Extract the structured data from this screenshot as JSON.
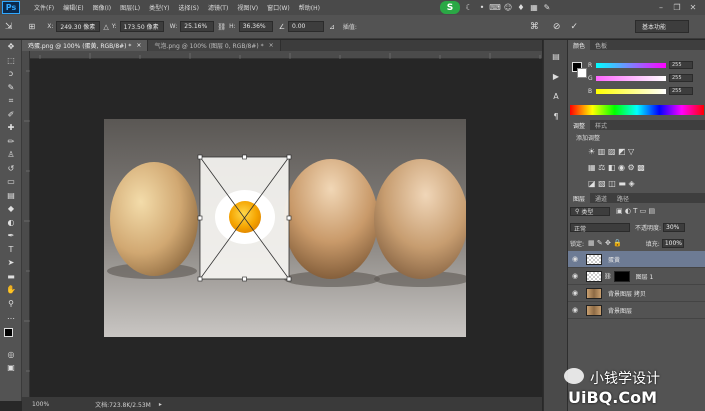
{
  "menubar": {
    "logo": "Ps",
    "items": [
      "文件(F)",
      "编辑(E)",
      "图像(I)",
      "图层(L)",
      "类型(Y)",
      "选择(S)",
      "滤镜(T)",
      "视图(V)",
      "窗口(W)",
      "帮助(H)"
    ],
    "badge": "S"
  },
  "options": {
    "x_label": "X:",
    "x_value": "249.30 像素",
    "y_label": "Y:",
    "y_value": "173.50 像素",
    "w_label": "W:",
    "w_value": "25.16%",
    "h_label": "H:",
    "h_value": "36.36%",
    "angle_value": "0.00",
    "interp_label": "插值:",
    "workspace": "基本功能"
  },
  "tabs": [
    {
      "label": "鸡蛋.png @ 100% (蛋黄, RGB/8#) *",
      "active": true
    },
    {
      "label": "气泡.png @ 100% (图层 0, RGB/8#) *",
      "active": false
    }
  ],
  "status": {
    "zoom": "100%",
    "doc": "文档:723.8K/2.53M"
  },
  "color_panel": {
    "tabs": [
      "颜色",
      "色板"
    ],
    "rows": [
      {
        "label": "R",
        "value": "255",
        "color": "#ff3a3a"
      },
      {
        "label": "G",
        "value": "255",
        "color": "#3aff3a"
      },
      {
        "label": "B",
        "value": "255",
        "color": "#3a6aff"
      }
    ]
  },
  "adjust_panel": {
    "tabs": [
      "调整",
      "样式"
    ],
    "add_label": "添加调整"
  },
  "layers_panel": {
    "tabs": [
      "图层",
      "通道",
      "路径"
    ],
    "kind_label": "类型",
    "blend_mode": "正常",
    "opacity_label": "不透明度:",
    "opacity_value": "30%",
    "lock_label": "锁定:",
    "fill_label": "填充:",
    "fill_value": "100%",
    "layers": [
      {
        "name": "蛋黄",
        "selected": true
      },
      {
        "name": "图层 1",
        "selected": false
      },
      {
        "name": "背景图层 拷贝",
        "selected": false
      },
      {
        "name": "背景图层",
        "selected": false
      }
    ]
  },
  "watermark": {
    "text": "小钱学设计",
    "url": "UiBQ.CoM"
  }
}
